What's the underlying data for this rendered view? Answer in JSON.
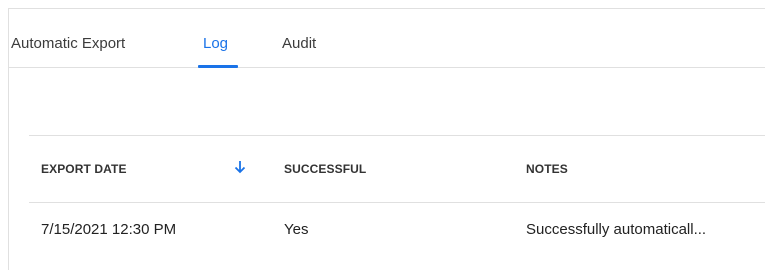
{
  "tabs": [
    {
      "label": "Automatic Export"
    },
    {
      "label": "Log"
    },
    {
      "label": "Audit"
    }
  ],
  "active_tab": "Log",
  "table": {
    "headers": [
      "EXPORT DATE",
      "SUCCESSFUL",
      "NOTES"
    ],
    "sort_icon": "arrow-down-icon",
    "rows": [
      [
        "7/15/2021 12:30 PM",
        "Yes",
        "Successfully automaticall..."
      ]
    ]
  },
  "colors": {
    "accent": "#1a73e8",
    "divider": "#e0e0e0"
  }
}
